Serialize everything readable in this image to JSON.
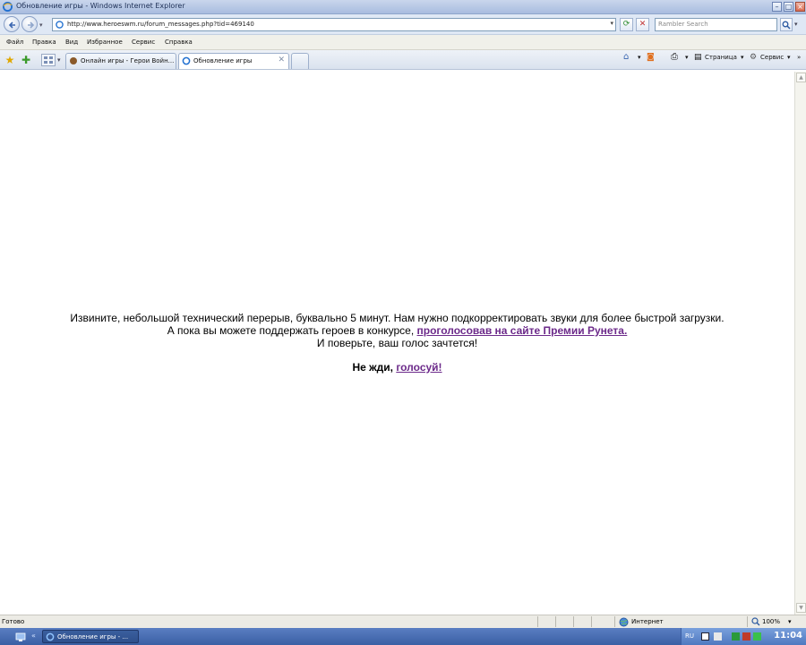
{
  "window": {
    "title": "Обновление игры - Windows Internet Explorer"
  },
  "address_bar": {
    "url": "http://www.heroeswm.ru/forum_messages.php?tid=469140",
    "search_placeholder": "Rambler Search"
  },
  "menu": {
    "items": [
      "Файл",
      "Правка",
      "Вид",
      "Избранное",
      "Сервис",
      "Справка"
    ]
  },
  "tabs": [
    {
      "label": "Онлайн игры - Герои Войн...",
      "active": false
    },
    {
      "label": "Обновление игры",
      "active": true
    }
  ],
  "toolbar_right": {
    "page_label": "Страница",
    "tools_label": "Сервис"
  },
  "content": {
    "line1": "Извините, небольшой технический перерыв, буквально 5 минут. Нам нужно подкорректировать звуки для более быстрой загрузки.",
    "line2_prefix": "А пока вы можете поддержать героев в конкурсе,",
    "line2_link": "проголосовав на сайте Премии Рунета.",
    "line3": "И поверьте, ваш голос зачтется!",
    "cta_prefix": "Не жди,",
    "cta_link": "голосуй!"
  },
  "status_bar": {
    "status": "Готово",
    "zone": "Интернет",
    "zoom": "100%"
  },
  "taskbar": {
    "window_button": "Обновление игры - ...",
    "language": "RU",
    "clock": "11:04"
  },
  "colors": {
    "link": "#6c2a8a",
    "titlebar": "#a8bcdf",
    "taskbar": "#3a5fa4"
  }
}
